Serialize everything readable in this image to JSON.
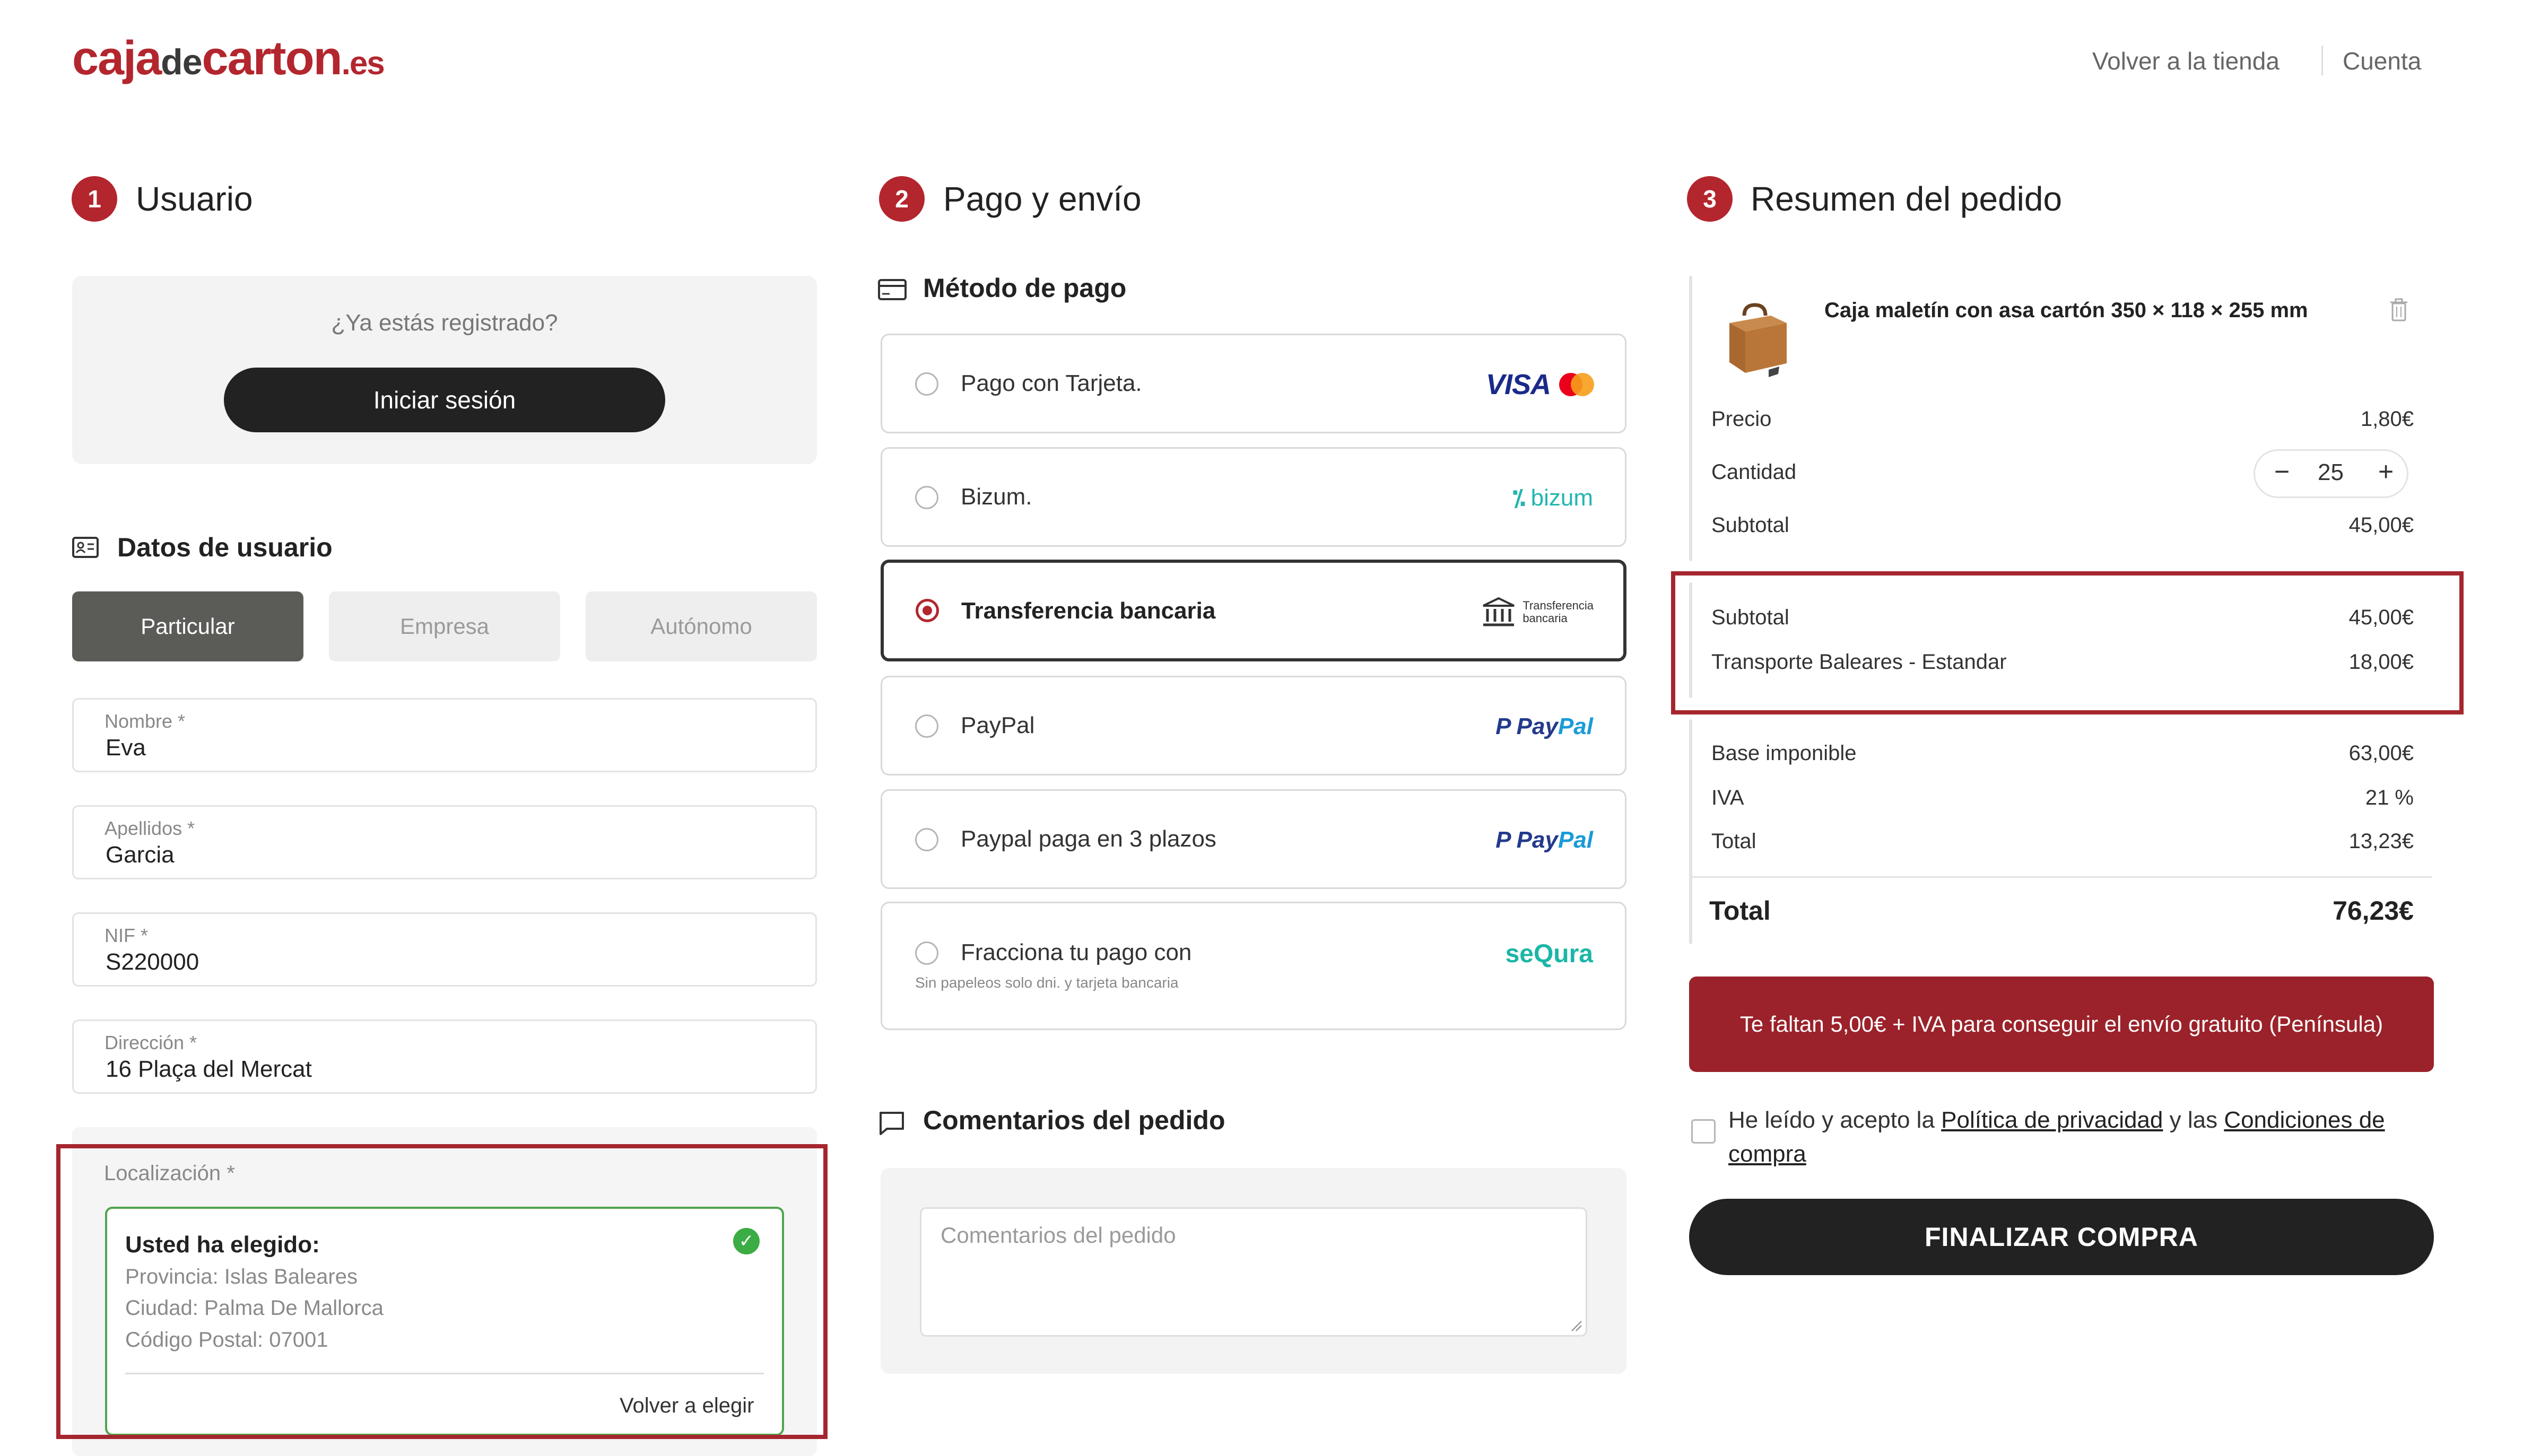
{
  "header": {
    "logo": {
      "part1": "caja",
      "part2": "de",
      "part3": "carton",
      "part4": ".es"
    },
    "links": [
      "Volver a la tienda",
      "Cuenta"
    ]
  },
  "user_section": {
    "step": "1",
    "title": "Usuario",
    "login_question": "¿Ya estás registrado?",
    "login_button": "Iniciar sesión",
    "data_title": "Datos de usuario",
    "tabs": [
      "Particular",
      "Empresa",
      "Autónomo"
    ],
    "fields": [
      {
        "label": "Nombre *",
        "value": "Eva"
      },
      {
        "label": "Apellidos *",
        "value": "Garcia"
      },
      {
        "label": "NIF *",
        "value": "S220000"
      },
      {
        "label": "Dirección *",
        "value": "16 Plaça del Mercat"
      }
    ],
    "location": {
      "label": "Localización *",
      "chosen_title": "Usted ha elegido:",
      "province": "Provincia: Islas Baleares",
      "city": "Ciudad: Palma De Mallorca",
      "postal": "Código Postal: 07001",
      "back": "Volver a elegir"
    }
  },
  "payment_section": {
    "step": "2",
    "title": "Pago y envío",
    "method_title": "Método de pago",
    "options": [
      {
        "label": "Pago con Tarjeta.",
        "logo": "VISA"
      },
      {
        "label": "Bizum.",
        "logo": "bizum"
      },
      {
        "label": "Transferencia bancaria",
        "logo_line1": "Transferencia",
        "logo_line2": "bancaria",
        "selected": true
      },
      {
        "label": "PayPal",
        "logo1": "Pay",
        "logo2": "Pal"
      },
      {
        "label": "Paypal paga en 3 plazos",
        "logo1": "Pay",
        "logo2": "Pal"
      },
      {
        "label": "Fracciona tu pago con",
        "note": "Sin papeleos solo dni. y tarjeta bancaria",
        "logo": "seQura"
      }
    ],
    "comments_title": "Comentarios del pedido",
    "comments_placeholder": "Comentarios del pedido"
  },
  "summary_section": {
    "step": "3",
    "title": "Resumen del pedido",
    "product": {
      "name": "Caja maletín con asa cartón 350 × 118 × 255 mm",
      "price_label": "Precio",
      "price": "1,80€",
      "qty_label": "Cantidad",
      "qty": "25",
      "subtotal_label": "Subtotal",
      "subtotal": "45,00€"
    },
    "shipping": {
      "subtotal_label": "Subtotal",
      "subtotal": "45,00€",
      "transport_label": "Transporte Baleares - Estandar",
      "transport": "18,00€"
    },
    "taxes": {
      "base_label": "Base imponible",
      "base": "63,00€",
      "iva_label": "IVA",
      "iva": "21 %",
      "total_label": "Total",
      "total": "13,23€"
    },
    "grand_total_label": "Total",
    "grand_total": "76,23€",
    "promo": "Te faltan 5,00€ + IVA para conseguir el envío gratuito (Península)",
    "terms": {
      "pre": "He leído y acepto la ",
      "privacy": "Política de privacidad",
      "mid": " y las ",
      "conditions": "Condiciones de compra"
    },
    "final_button": "FINALIZAR COMPRA"
  },
  "colors": {
    "brand": "#b3262e",
    "dark": "#222222",
    "promo": "#9b222a",
    "success": "#3cac44"
  }
}
